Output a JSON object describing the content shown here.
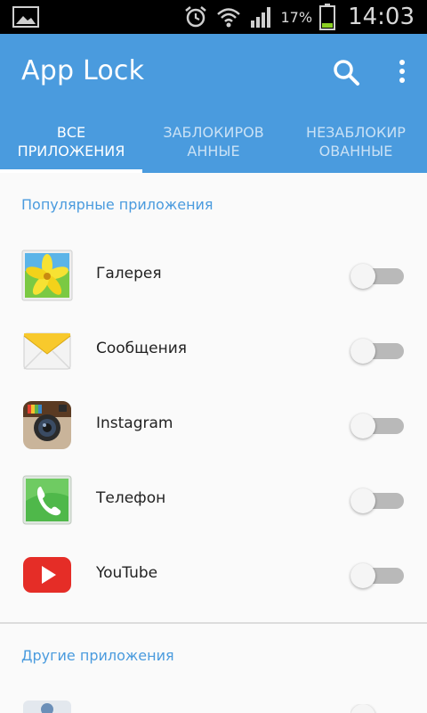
{
  "status_bar": {
    "battery_percent": "17%",
    "time": "14:03",
    "icons": [
      "gallery-icon",
      "alarm-icon",
      "wifi-icon",
      "signal-icon",
      "battery-icon"
    ]
  },
  "app_bar": {
    "title": "App Lock",
    "accent_color": "#4a9bde",
    "actions": [
      "search-icon",
      "more-vert-icon"
    ]
  },
  "tabs": [
    {
      "line1": "ВСЕ",
      "line2": "ПРИЛОЖЕНИЯ",
      "active": true
    },
    {
      "line1": "ЗАБЛОКИРОВ",
      "line2": "АННЫЕ",
      "active": false
    },
    {
      "line1": "НЕЗАБЛОКИР",
      "line2": "ОВАННЫЕ",
      "active": false
    }
  ],
  "popular": {
    "header": "Популярные приложения",
    "apps": [
      {
        "name": "Галерея",
        "icon": "gallery-app-icon",
        "locked": false
      },
      {
        "name": "Сообщения",
        "icon": "messages-app-icon",
        "locked": false
      },
      {
        "name": "Instagram",
        "icon": "instagram-app-icon",
        "locked": false
      },
      {
        "name": "Телефон",
        "icon": "phone-app-icon",
        "locked": false
      },
      {
        "name": "YouTube",
        "icon": "youtube-app-icon",
        "locked": false
      }
    ]
  },
  "other": {
    "header": "Другие приложения"
  }
}
